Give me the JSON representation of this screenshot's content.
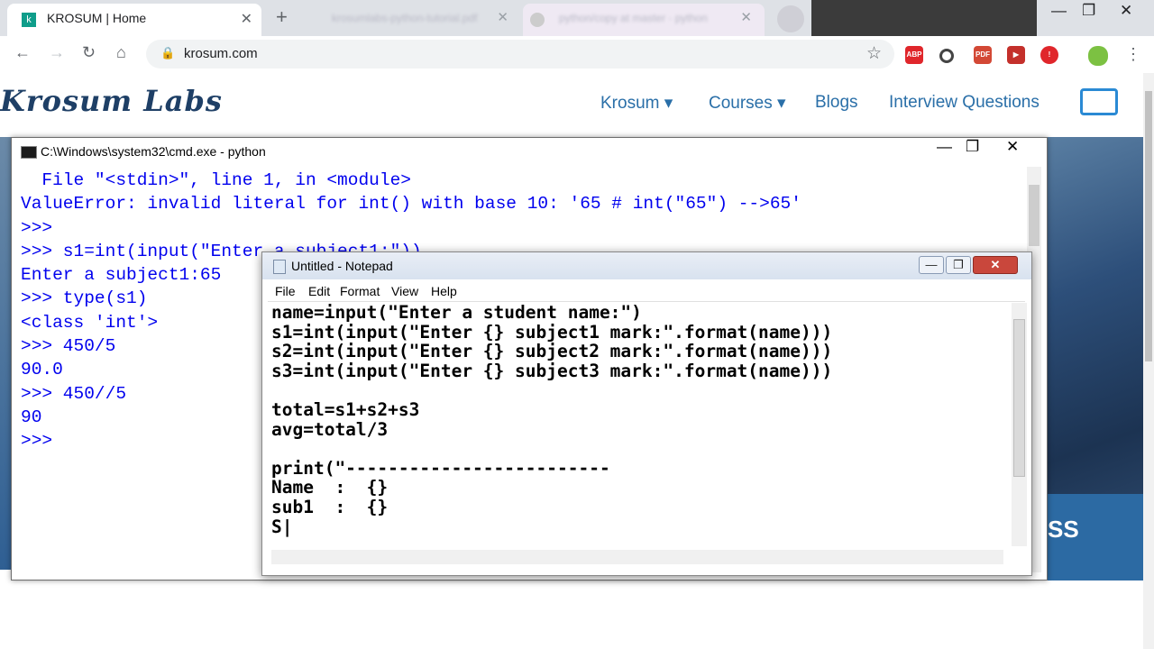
{
  "browser": {
    "active_tab_title": "KROSUM | Home",
    "active_tab_favicon": "k",
    "tab_close": "✕",
    "bg_tab1_title": "krosumlabs-python-tutorial.pdf",
    "bg_tab2_title": "python/copy at master · python",
    "new_tab": "+",
    "url": "krosum.com",
    "window_controls": [
      "—",
      "❐",
      "✕"
    ],
    "extensions": [
      {
        "name": "adblock-icon",
        "label": "ABP",
        "color": "#e0262b"
      },
      {
        "name": "circle-extension-icon",
        "label": "",
        "color": "#444444"
      },
      {
        "name": "pdf-extension-icon",
        "label": "PDF",
        "color": "#d34835"
      },
      {
        "name": "video-extension-icon",
        "label": "▶",
        "color": "#c4302b"
      },
      {
        "name": "shield-extension-icon",
        "label": "!",
        "color": "#e0262b"
      },
      {
        "name": "profile-avatar-icon",
        "label": "",
        "color": "#7cc142"
      }
    ]
  },
  "site": {
    "logo": "Krosum Labs",
    "nav": [
      "Krosum ▾",
      "Courses ▾",
      "Blogs",
      "Interview Questions"
    ],
    "hero_partial_text": "SS"
  },
  "cmd": {
    "title": "C:\\Windows\\system32\\cmd.exe - python",
    "lines": [
      "  File \"<stdin>\", line 1, in <module>",
      "ValueError: invalid literal for int() with base 10: '65 # int(\"65\") -->65'",
      ">>>",
      ">>> s1=int(input(\"Enter a subject1:\"))",
      "Enter a subject1:65",
      ">>> type(s1)",
      "<class 'int'>",
      ">>> 450/5",
      "90.0",
      ">>> 450//5",
      "90",
      ">>>"
    ]
  },
  "notepad": {
    "title": "Untitled - Notepad",
    "menus": [
      "File",
      "Edit",
      "Format",
      "View",
      "Help"
    ],
    "lines": [
      "name=input(\"Enter a student name:\")",
      "s1=int(input(\"Enter {} subject1 mark:\".format(name)))",
      "s2=int(input(\"Enter {} subject2 mark:\".format(name)))",
      "s3=int(input(\"Enter {} subject3 mark:\".format(name)))",
      "",
      "total=s1+s2+s3",
      "avg=total/3",
      "",
      "print(\"-------------------------",
      "Name  :  {}",
      "sub1  :  {}",
      "S|"
    ]
  }
}
